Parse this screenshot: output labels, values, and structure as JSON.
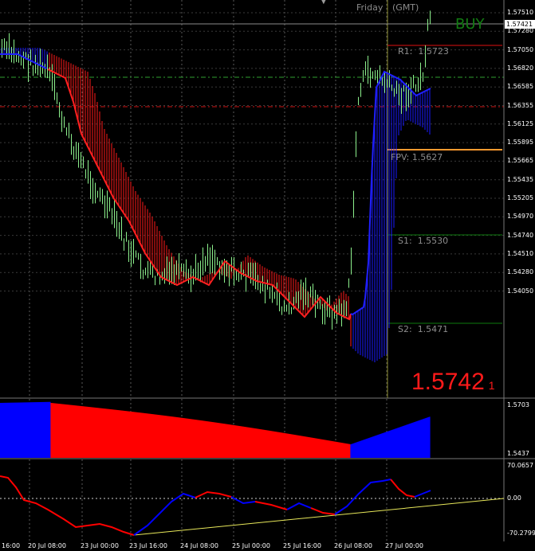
{
  "header": {
    "day": "Friday",
    "timezone": "(GMT)"
  },
  "signal": {
    "text": "BUY",
    "color": "#127c12"
  },
  "price_display": {
    "value": "1.5742",
    "suffix": "1",
    "color": "#ff1a1a"
  },
  "pivots": {
    "r1": {
      "label": "R1:",
      "value": "1.5723"
    },
    "fpv": {
      "label": "FPV:",
      "value": "1.5627"
    },
    "s1": {
      "label": "S1:",
      "value": "1.5530"
    },
    "s2": {
      "label": "S2:",
      "value": "1.5471"
    }
  },
  "price_axis": {
    "current": "1.57421",
    "ticks": [
      "1.57510",
      "1.57280",
      "1.57050",
      "1.56820",
      "1.56585",
      "1.56355",
      "1.56125",
      "1.55895",
      "1.55665",
      "1.55435",
      "1.55205",
      "1.54970",
      "1.54740",
      "1.54510",
      "1.54280",
      "1.54050"
    ]
  },
  "time_axis": {
    "labels": [
      "16:00",
      "20 Jul 08:00",
      "23 Jul 00:00",
      "23 Jul 16:00",
      "24 Jul 08:00",
      "25 Jul 00:00",
      "25 Jul 16:00",
      "26 Jul 08:00",
      "27 Jul 00:00"
    ]
  },
  "indicator1": {
    "top": "1.5703",
    "bottom": "1.5437"
  },
  "indicator2": {
    "top": "70.0657",
    "zero": "0.00",
    "bottom": "-70.2799"
  },
  "colors": {
    "up_band": "#1a1aff",
    "down_band": "#ff0000",
    "candle": "#8cf08c",
    "grid": "#6e6e6e"
  }
}
